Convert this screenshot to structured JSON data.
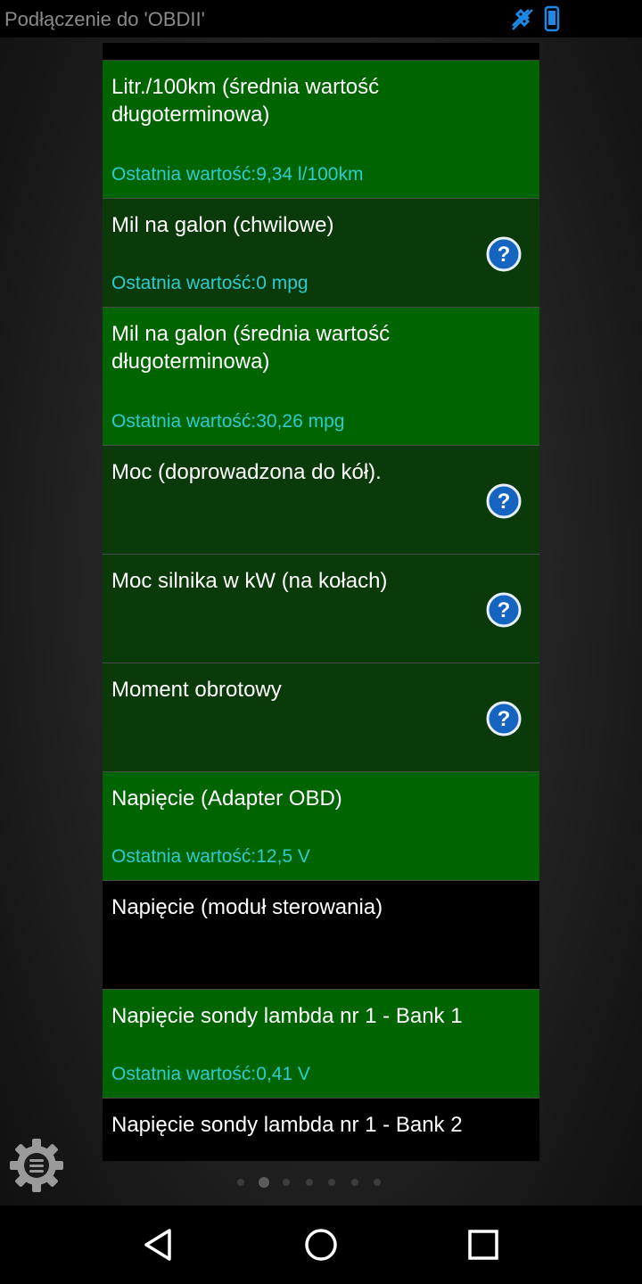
{
  "status_bar": {
    "title": "Podłączenie do 'OBDII'",
    "icons": [
      "gps-off-icon",
      "phone-icon"
    ],
    "icon_color": "#1e88e5"
  },
  "list": {
    "items": [
      {
        "label": "Litr./100km (średnia wartość długoterminowa)",
        "last_value": "Ostatnia wartość:9,34 l/100km",
        "help": false,
        "style": "bright"
      },
      {
        "label": "Mil na galon (chwilowe)",
        "last_value": "Ostatnia wartość:0 mpg",
        "help": true,
        "style": "dark"
      },
      {
        "label": "Mil na galon (średnia wartość długoterminowa)",
        "last_value": "Ostatnia wartość:30,26 mpg",
        "help": false,
        "style": "bright"
      },
      {
        "label": "Moc (doprowadzona do kół).",
        "last_value": "",
        "help": true,
        "style": "dark"
      },
      {
        "label": "Moc silnika w kW (na kołach)",
        "last_value": "",
        "help": true,
        "style": "dark"
      },
      {
        "label": "Moment obrotowy",
        "last_value": "",
        "help": true,
        "style": "dark"
      },
      {
        "label": "Napięcie (Adapter OBD)",
        "last_value": "Ostatnia wartość:12,5 V",
        "help": false,
        "style": "bright"
      },
      {
        "label": "Napięcie (moduł sterowania)",
        "last_value": "",
        "help": false,
        "style": "black"
      },
      {
        "label": "Napięcie sondy lambda nr 1 - Bank 1",
        "last_value": "Ostatnia wartość:0,41 V",
        "help": false,
        "style": "bright"
      },
      {
        "label": "Napięcie sondy lambda nr 1 - Bank 2",
        "last_value": "",
        "help": false,
        "style": "black"
      }
    ],
    "colors": {
      "bright_row": "#006400",
      "dark_row": "#0a3a0a",
      "last_value_text": "#2ecbcf"
    }
  },
  "pager": {
    "total_pages": 7,
    "active_page": 2
  },
  "settings": {
    "icon": "gear-menu-icon"
  },
  "navigation_bar": {
    "icons": [
      "back-icon",
      "home-icon",
      "recents-icon"
    ]
  }
}
